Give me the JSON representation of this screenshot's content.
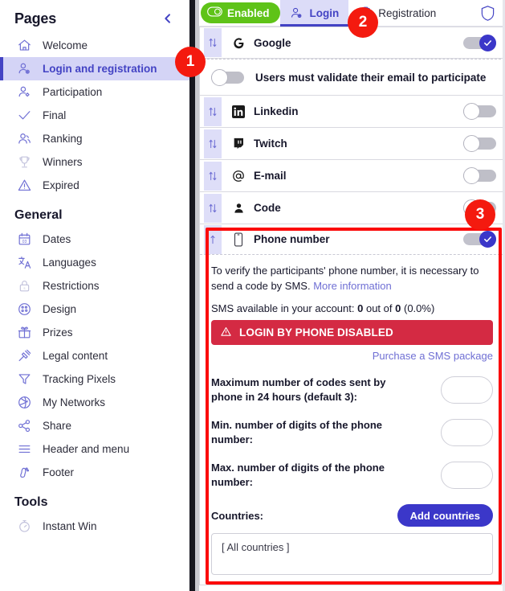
{
  "sidebar": {
    "title": "Pages",
    "collapse_icon": "chevron-left-icon",
    "groups": [
      {
        "label": "",
        "items": [
          {
            "label": "Welcome",
            "icon": "home-icon",
            "active": false,
            "dim": false
          },
          {
            "label": "Login and registration",
            "icon": "user-login-icon",
            "active": true,
            "dim": false
          },
          {
            "label": "Participation",
            "icon": "user-add-icon",
            "active": false,
            "dim": false
          },
          {
            "label": "Final",
            "icon": "check-icon",
            "active": false,
            "dim": false
          },
          {
            "label": "Ranking",
            "icon": "ranking-icon",
            "active": false,
            "dim": false
          },
          {
            "label": "Winners",
            "icon": "trophy-icon",
            "active": false,
            "dim": true
          },
          {
            "label": "Expired",
            "icon": "warning-triangle-icon",
            "active": false,
            "dim": false
          }
        ]
      },
      {
        "label": "General",
        "items": [
          {
            "label": "Dates",
            "icon": "calendar-icon",
            "active": false,
            "dim": false
          },
          {
            "label": "Languages",
            "icon": "translate-icon",
            "active": false,
            "dim": false
          },
          {
            "label": "Restrictions",
            "icon": "lock-icon",
            "active": false,
            "dim": true
          },
          {
            "label": "Design",
            "icon": "palette-icon",
            "active": false,
            "dim": false
          },
          {
            "label": "Prizes",
            "icon": "gift-icon",
            "active": false,
            "dim": false
          },
          {
            "label": "Legal content",
            "icon": "gavel-icon",
            "active": false,
            "dim": false
          },
          {
            "label": "Tracking Pixels",
            "icon": "funnel-icon",
            "active": false,
            "dim": false
          },
          {
            "label": "My Networks",
            "icon": "network-globe-icon",
            "active": false,
            "dim": false
          },
          {
            "label": "Share",
            "icon": "share-icon",
            "active": false,
            "dim": false
          },
          {
            "label": "Header and menu",
            "icon": "menu-lines-icon",
            "active": false,
            "dim": false
          },
          {
            "label": "Footer",
            "icon": "footprint-icon",
            "active": false,
            "dim": false
          }
        ]
      },
      {
        "label": "Tools",
        "items": [
          {
            "label": "Instant Win",
            "icon": "stopwatch-icon",
            "active": false,
            "dim": true
          }
        ]
      }
    ]
  },
  "tabbar": {
    "enabled_label": "Enabled",
    "enabled_icon": "toggle-on-icon",
    "enabled_color": "#5fc318",
    "tabs": [
      {
        "label": "Login",
        "icon": "user-login-icon",
        "active": true
      },
      {
        "label": "Registration",
        "icon": "clipboard-icon",
        "active": false
      }
    ],
    "shield_icon": "shield-icon"
  },
  "providers": [
    {
      "name": "Google",
      "icon": "google-icon",
      "enabled": true,
      "handle": "drag-handle-icon"
    },
    {
      "name": "Linkedin",
      "icon": "linkedin-icon",
      "enabled": false,
      "handle": "drag-handle-icon"
    },
    {
      "name": "Twitch",
      "icon": "twitch-icon",
      "enabled": false,
      "handle": "drag-handle-icon"
    },
    {
      "name": "E-mail",
      "icon": "at-icon",
      "enabled": false,
      "handle": "drag-handle-icon"
    },
    {
      "name": "Code",
      "icon": "person-icon",
      "enabled": false,
      "handle": "drag-handle-icon"
    }
  ],
  "validate_email": {
    "label": "Users must validate their email to participate",
    "enabled": false
  },
  "phone": {
    "name": "Phone number",
    "icon": "mobile-phone-icon",
    "handle": "drag-handle-up-icon",
    "enabled": true,
    "description": "To verify the participants' phone number, it is necessary to send a code by SMS.",
    "more_info_link": "More information",
    "sms_prefix": "SMS available in your account:",
    "sms_available": "0",
    "sms_middle": "out of",
    "sms_total": "0",
    "sms_percent": "(0.0%)",
    "alert_text": "LOGIN BY PHONE DISABLED",
    "alert_icon": "warning-triangle-icon",
    "alert_color": "#d42a43",
    "purchase_link": "Purchase a SMS package",
    "fields": [
      {
        "label": "Maximum number of codes sent by phone in 24 hours (default 3):",
        "value": ""
      },
      {
        "label": "Min. number of digits of the phone number:",
        "value": ""
      },
      {
        "label": "Max. number of digits of the phone number:",
        "value": ""
      }
    ],
    "countries_label": "Countries:",
    "add_countries_button": "Add countries",
    "countries_value": "[ All countries ]"
  },
  "annotations": [
    {
      "number": "1"
    },
    {
      "number": "2"
    },
    {
      "number": "3"
    }
  ],
  "colors": {
    "accent": "#4343c4",
    "highlight_frame": "#fb0b0b",
    "badge": "#f41a0f",
    "toggle_on": "#3b37c9"
  }
}
